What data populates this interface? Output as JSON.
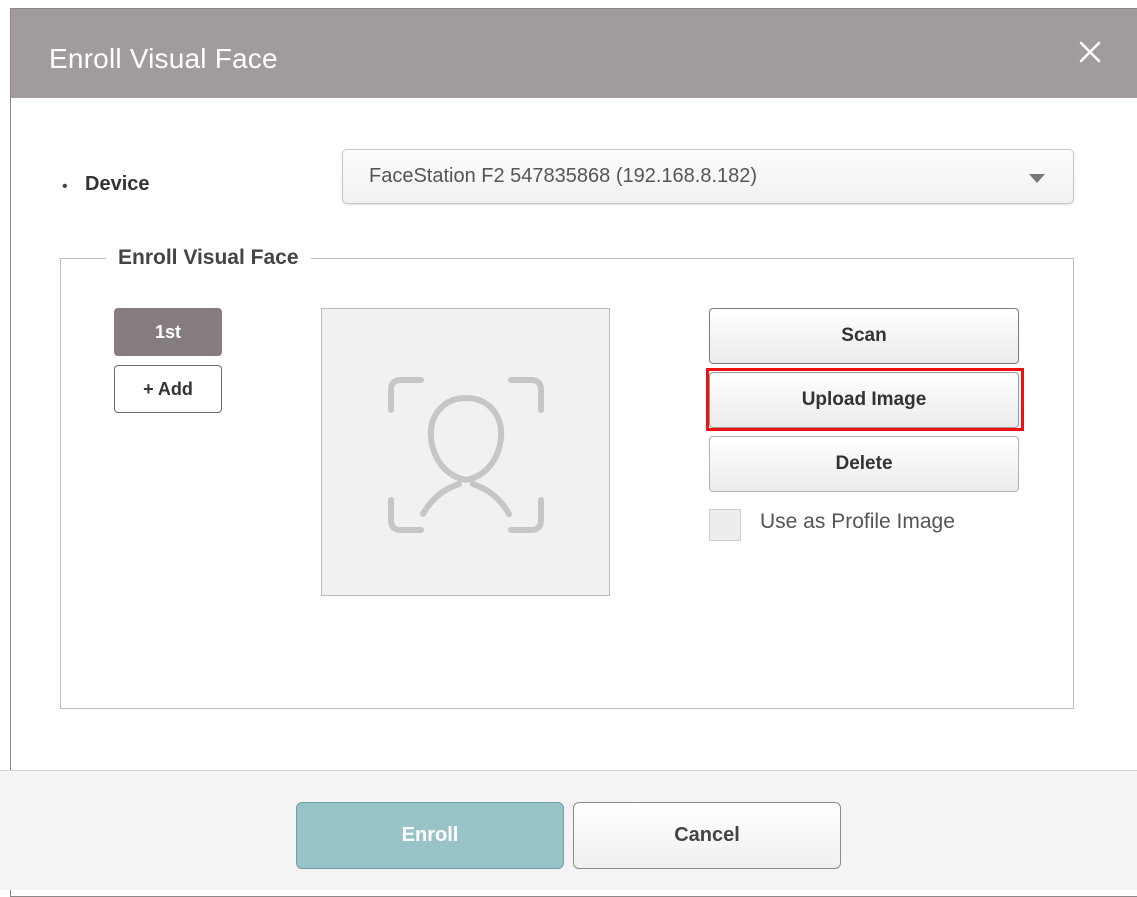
{
  "dialog": {
    "title": "Enroll Visual Face",
    "close_icon": "close-icon"
  },
  "device": {
    "bullet": "•",
    "label": "Device",
    "selected": "FaceStation F2 547835868 (192.168.8.182)"
  },
  "enroll_section": {
    "legend": "Enroll Visual Face",
    "tabs": [
      {
        "label": "1st",
        "active": true
      },
      {
        "label": "+ Add",
        "active": false
      }
    ],
    "face_placeholder_icon": "face-scan-icon",
    "buttons": {
      "scan": "Scan",
      "upload": "Upload Image",
      "delete": "Delete"
    },
    "profile_checkbox": {
      "label": "Use as Profile Image",
      "checked": false
    }
  },
  "footer": {
    "enroll": "Enroll",
    "cancel": "Cancel"
  },
  "colors": {
    "titlebar": "#a19b9b",
    "active_tab": "#857d7d",
    "enroll_button": "#98c4c8",
    "highlight": "#ee1111"
  }
}
